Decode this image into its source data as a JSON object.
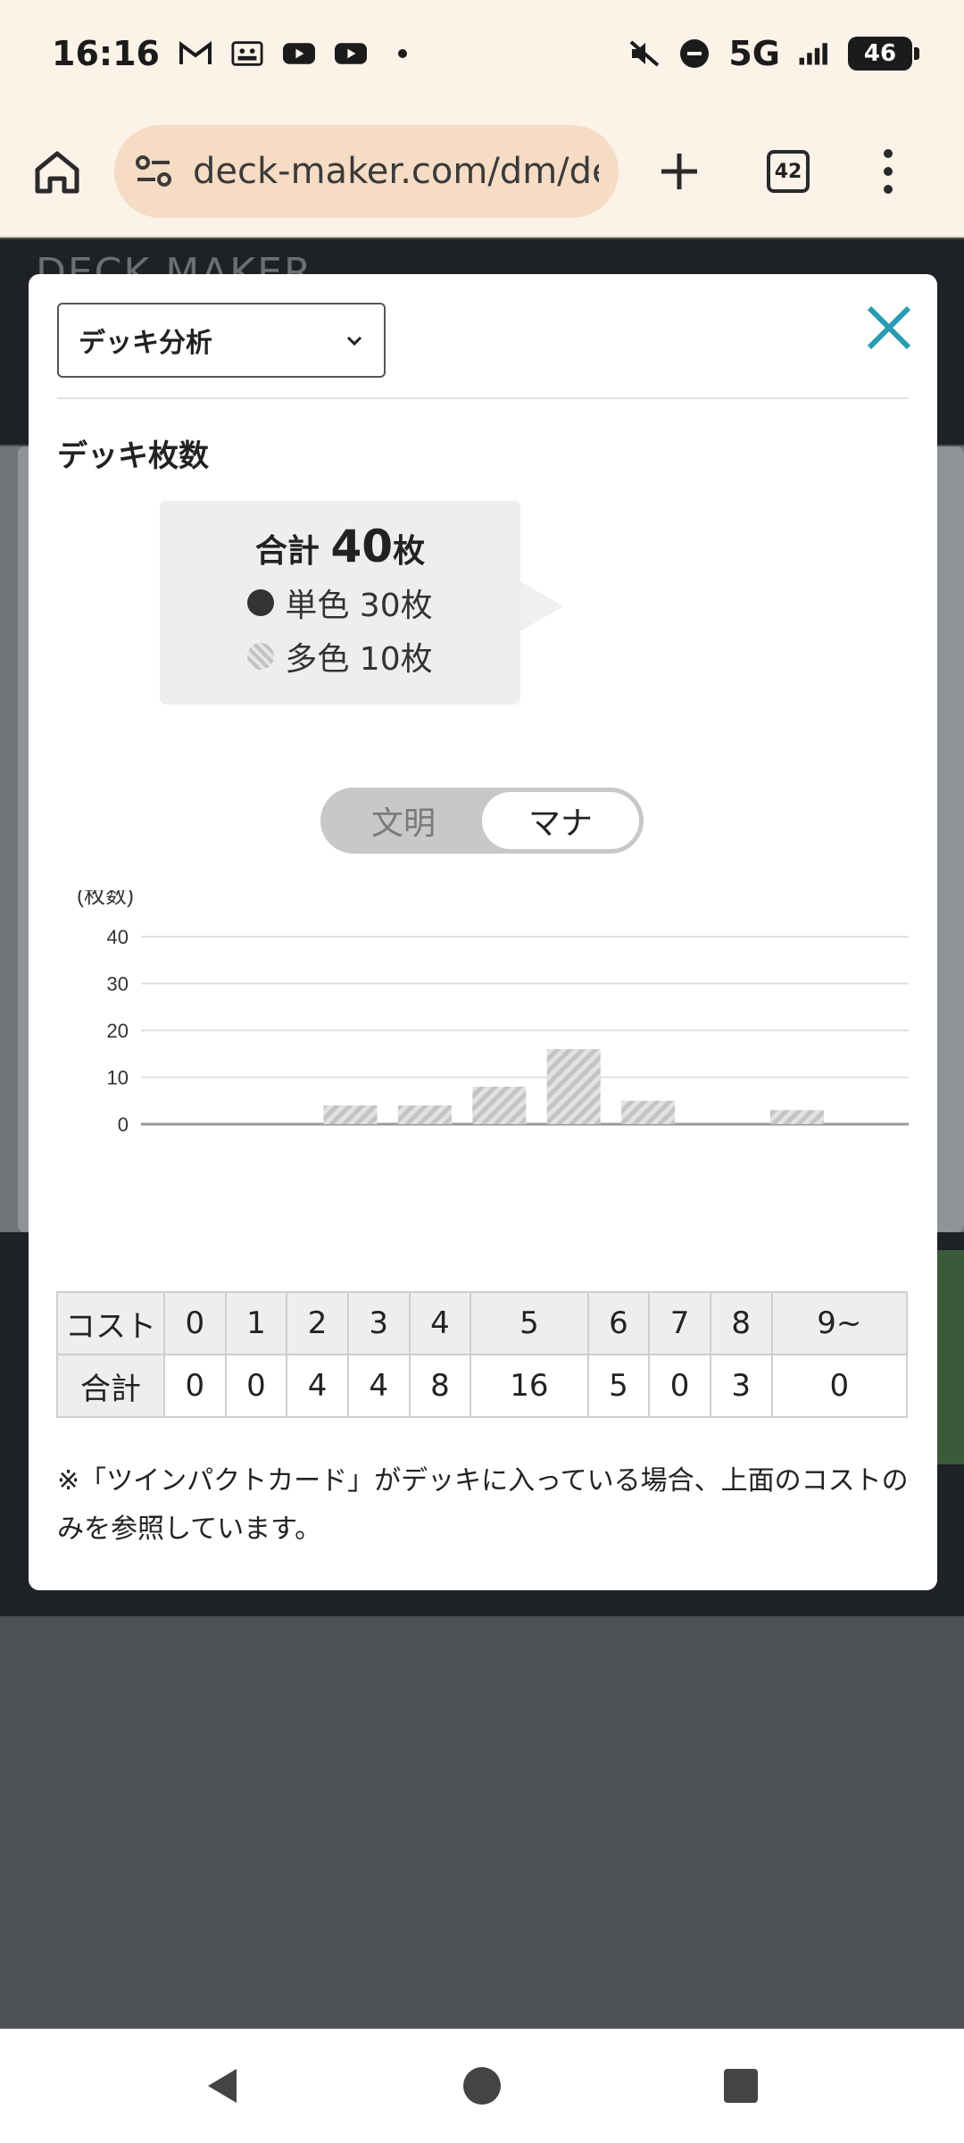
{
  "status_bar": {
    "time": "16:16",
    "network": "5G",
    "battery": "46"
  },
  "browser": {
    "url": "deck-maker.com/dm/dec",
    "tab_count": "42"
  },
  "background_page": {
    "logo": "DECK MAKER"
  },
  "modal": {
    "dropdown_value": "デッキ分析",
    "section_title": "デッキ枚数",
    "summary": {
      "total_label": "合計",
      "total_count": "40",
      "total_unit": "枚",
      "mono_label": "単色 30枚",
      "multi_label": "多色 10枚"
    },
    "toggle": {
      "options": [
        "文明",
        "マナ"
      ],
      "active": "マナ"
    },
    "table": {
      "cost_header": "コスト",
      "total_header": "合計",
      "costs": [
        "0",
        "1",
        "2",
        "3",
        "4",
        "5",
        "6",
        "7",
        "8",
        "9~"
      ],
      "totals": [
        "0",
        "0",
        "4",
        "4",
        "8",
        "16",
        "5",
        "0",
        "3",
        "0"
      ]
    },
    "note": "※「ツインパクトカード」がデッキに入っている場合、上面のコストのみを参照しています。"
  },
  "chart_data": {
    "type": "bar",
    "ylabel": "(枚数)",
    "categories": [
      "0",
      "1",
      "2",
      "3",
      "4",
      "5",
      "6",
      "7",
      "8",
      "9~"
    ],
    "values": [
      0,
      0,
      4,
      4,
      8,
      16,
      5,
      0,
      3,
      0
    ],
    "yticks": [
      0,
      10,
      20,
      30,
      40
    ],
    "ylim": [
      0,
      40
    ],
    "grid": true,
    "bar_color": "#c8c8c8"
  }
}
